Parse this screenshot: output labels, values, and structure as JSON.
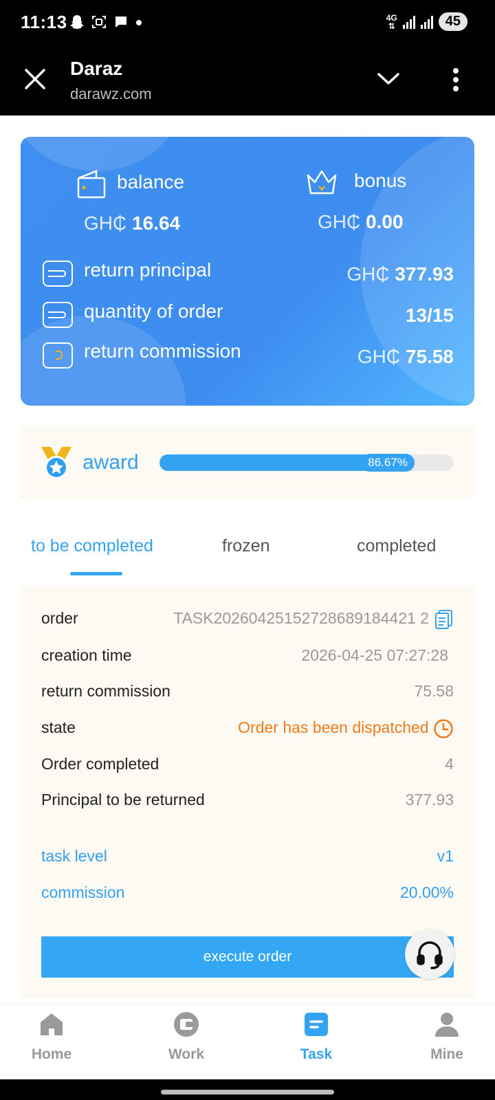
{
  "status_bar": {
    "time": "11:13",
    "network": "4G",
    "battery": "45"
  },
  "browser": {
    "title": "Daraz",
    "url": "darawz.com"
  },
  "summary": {
    "balance_label": "balance",
    "balance_currency": "GH₵",
    "balance_value": "16.64",
    "bonus_label": "bonus",
    "bonus_currency": "GH₵",
    "bonus_value": "0.00",
    "return_principal_label": "return principal",
    "return_principal_currency": "GH₵",
    "return_principal_value": "377.93",
    "quantity_label": "quantity of order",
    "quantity_value": "13/15",
    "return_commission_label": "return commission",
    "return_commission_currency": "GH₵",
    "return_commission_value": "75.58"
  },
  "award": {
    "label": "award",
    "progress_text": "86.67%",
    "progress_fraction": 0.8667
  },
  "tabs": [
    {
      "label": "to be completed",
      "active": true
    },
    {
      "label": "frozen",
      "active": false
    },
    {
      "label": "completed",
      "active": false
    }
  ],
  "order": {
    "order_label": "order",
    "order_value": "TASK20260425152728689184421 2",
    "creation_label": "creation time",
    "creation_value": "2026-04-25 07:27:28",
    "commission_label": "return commission",
    "commission_value": "75.58",
    "state_label": "state",
    "state_value": "Order has been dispatched",
    "completed_label": "Order completed",
    "completed_value": "4",
    "principal_label": "Principal to be returned",
    "principal_value": "377.93",
    "task_level_label": "task level",
    "task_level_value": "v1",
    "commission_rate_label": "commission",
    "commission_rate_value": "20.00%",
    "execute_label": "execute order"
  },
  "nav": [
    {
      "label": "Home",
      "icon": "home-icon",
      "active": false
    },
    {
      "label": "Work",
      "icon": "wallet-icon",
      "active": false
    },
    {
      "label": "Task",
      "icon": "task-icon",
      "active": true
    },
    {
      "label": "Mine",
      "icon": "user-icon",
      "active": false
    }
  ],
  "colors": {
    "accent": "#33a3f2",
    "card_blue": "#3d8cf0",
    "state_orange": "#ee7a1a",
    "panel_bg": "#fdf9f3"
  }
}
